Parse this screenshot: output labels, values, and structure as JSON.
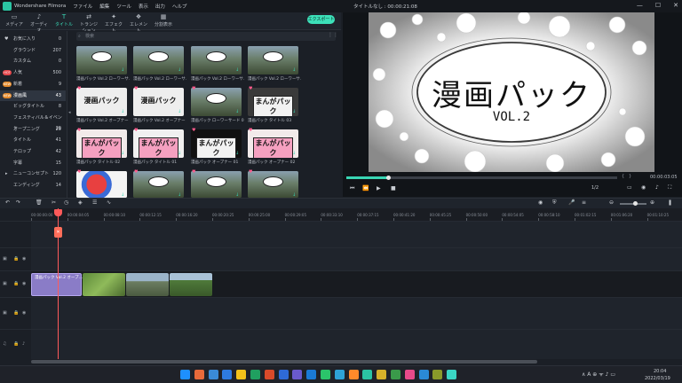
{
  "titlebar": {
    "app": "Wondershare Filmora",
    "menus": [
      "ファイル",
      "編集",
      "ツール",
      "表示",
      "出力",
      "ヘルプ"
    ],
    "project": "タイトルなし : 00:00:21:08"
  },
  "tabs": [
    {
      "label": "メディア",
      "icon": "media-icon"
    },
    {
      "label": "オーディオ",
      "icon": "music-icon"
    },
    {
      "label": "タイトル",
      "icon": "title-icon",
      "active": true
    },
    {
      "label": "トランジション",
      "icon": "transition-icon"
    },
    {
      "label": "エフェクト",
      "icon": "effect-icon"
    },
    {
      "label": "エレメント",
      "icon": "element-icon"
    },
    {
      "label": "分割表示",
      "icon": "split-icon"
    }
  ],
  "export_label": "エクスポート",
  "sidebar": [
    {
      "label": "お気に入り",
      "count": "0"
    },
    {
      "label": "グラウンド",
      "count": "207"
    },
    {
      "label": "カスタム",
      "count": "0"
    },
    {
      "label": "人気",
      "count": "500",
      "badge": "HOT",
      "badge_color": "#e5484d"
    },
    {
      "label": "新着",
      "count": "9",
      "badge": "NEW",
      "badge_color": "#e58a2b"
    },
    {
      "label": "漫画風",
      "count": "43",
      "badge": "NEW",
      "badge_color": "#e58a2b",
      "selected": true
    },
    {
      "label": "ビッグタイトル",
      "count": "8"
    },
    {
      "label": "フェスティバル＆イベント",
      "count": "29"
    },
    {
      "label": "オープニング",
      "count": "29"
    },
    {
      "label": "タイトル",
      "count": "41"
    },
    {
      "label": "テロップ",
      "count": "42"
    },
    {
      "label": "字幕",
      "count": "15"
    },
    {
      "label": "ニューコンセプト",
      "count": "120"
    },
    {
      "label": "エンディング",
      "count": "14"
    }
  ],
  "search_placeholder": "検索",
  "thumbs": [
    {
      "caption": "漫画パック Vol.2 ローワーサ…",
      "text": "",
      "bg": "#3a4a3a"
    },
    {
      "caption": "漫画パック Vol.2 ローワーサ…",
      "text": "",
      "bg": "#3a4a3a"
    },
    {
      "caption": "漫画パック Vol.2 ローワーサ…",
      "text": "",
      "bg": "#3a4a3a"
    },
    {
      "caption": "漫画パック Vol.2 ローワーサ…",
      "text": "",
      "bg": "#3a4a3a"
    },
    {
      "caption": "漫画パック Vol.2 オープナー 01",
      "text": "漫画パック",
      "bg": "#eeeeee"
    },
    {
      "caption": "漫画パック Vol.2 オープナー 02",
      "text": "漫画パック",
      "bg": "#eeeeee"
    },
    {
      "caption": "漫画パック ローワーサード 03",
      "text": "",
      "bg": "#3a4a3a"
    },
    {
      "caption": "漫画パック タイトル 03",
      "text": "まんがパック",
      "bg": "#3a3a3a"
    },
    {
      "caption": "漫画パック タイトル 02",
      "text": "まんがパック",
      "bg": "#f2eaea"
    },
    {
      "caption": "漫画パック タイトル 01",
      "text": "まんがパック",
      "bg": "#f0f0f0"
    },
    {
      "caption": "漫画パック オープナー 01",
      "text": "まんがパック",
      "bg": "#111111"
    },
    {
      "caption": "漫画パック オープナー 02",
      "text": "まんがパック",
      "bg": "#f2eaea"
    },
    {
      "caption": "",
      "text": "",
      "bg": "#f4f4f4"
    },
    {
      "caption": "",
      "text": "",
      "bg": "#3a4a3a"
    },
    {
      "caption": "",
      "text": "",
      "bg": "#3a4a3a"
    },
    {
      "caption": "",
      "text": "",
      "bg": "#3a4a3a"
    }
  ],
  "preview": {
    "title_main": "漫画パック",
    "title_sub": "VOL.2",
    "timecode": "00:00:03:05",
    "ratio": "1/2",
    "progress": 0.15
  },
  "ruler": [
    "00:00:00:00",
    "00:00:04:05",
    "00:00:08:10",
    "00:00:12:15",
    "00:00:16:20",
    "00:00:20:25",
    "00:00:25:00",
    "00:00:29:05",
    "00:00:33:10",
    "00:00:37:15",
    "00:00:41:20",
    "00:00:45:25",
    "00:00:50:00",
    "00:00:54:05",
    "00:00:58:10",
    "00:01:02:15",
    "00:01:06:20",
    "00:01:10:25"
  ],
  "clips": {
    "title_clip": "漫画パック Vol.2 オープ…"
  },
  "taskbar": {
    "time": "20:04",
    "date": "2022/03/19"
  }
}
